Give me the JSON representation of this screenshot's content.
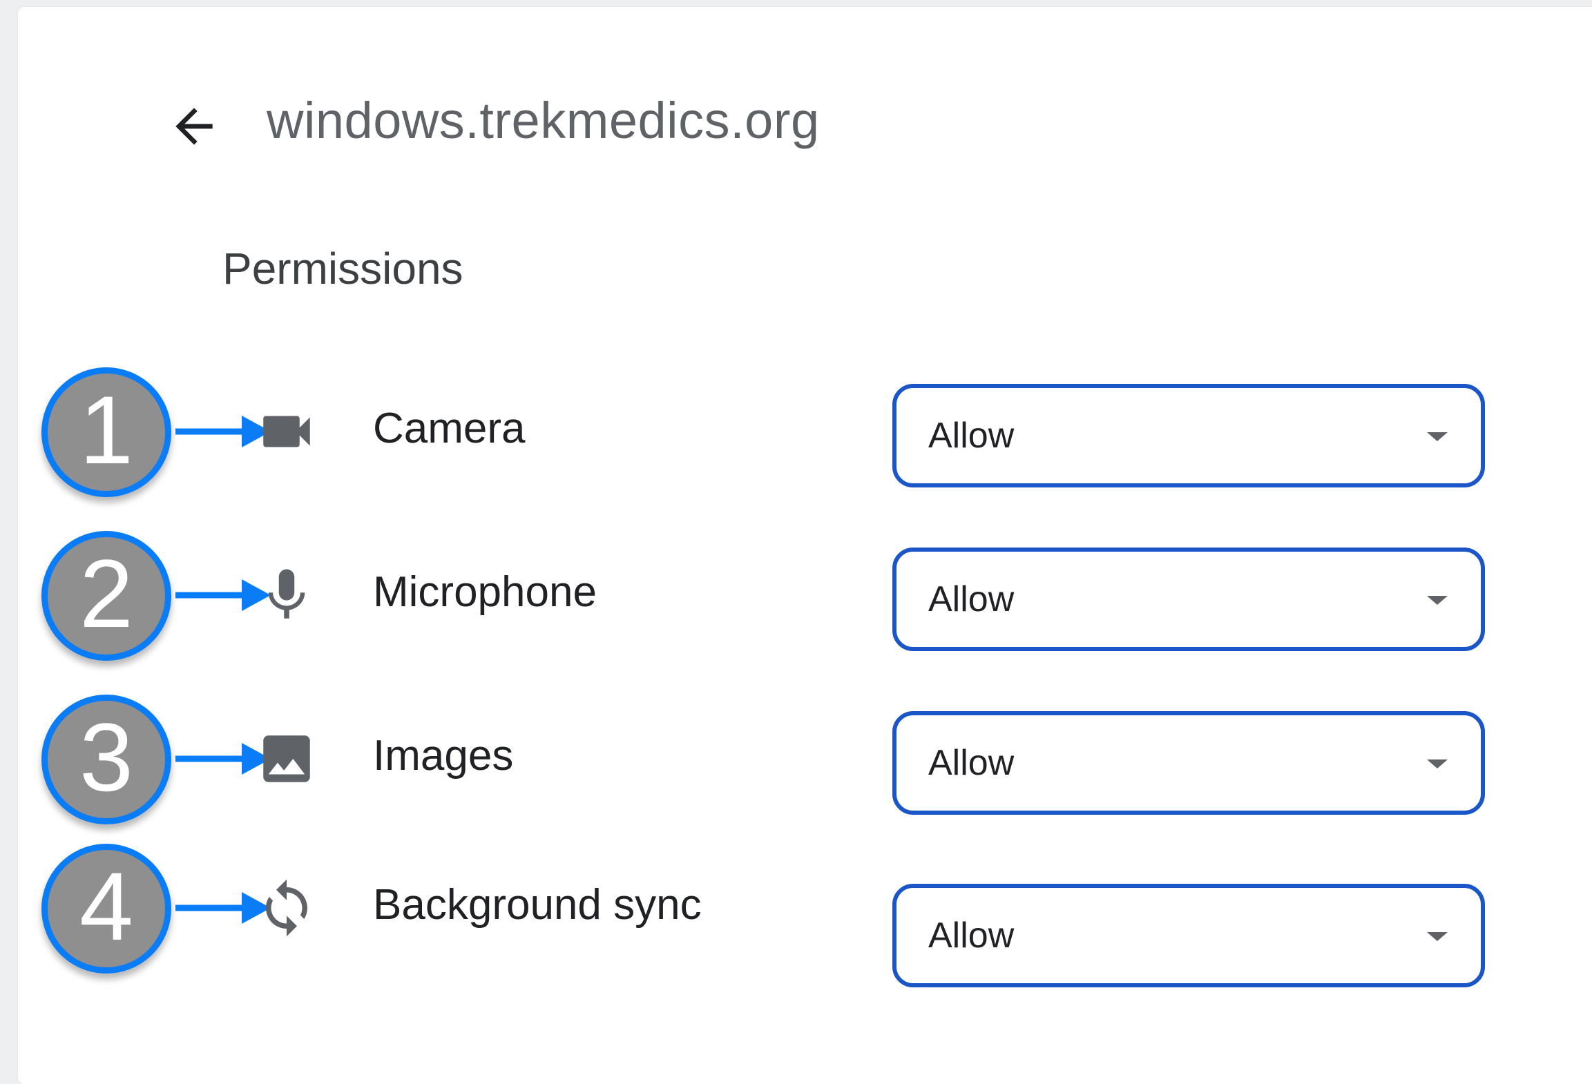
{
  "header": {
    "back_icon": "arrow-back-icon",
    "site": "windows.trekmedics.org"
  },
  "section": {
    "title": "Permissions"
  },
  "colors": {
    "accent_blue": "#0a7cf5",
    "select_border": "#1a56c8",
    "badge_gray": "#8f8f8f",
    "icon_gray": "#5f6368"
  },
  "permissions": [
    {
      "badge": "1",
      "icon": "camera-icon",
      "label": "Camera",
      "value": "Allow"
    },
    {
      "badge": "2",
      "icon": "microphone-icon",
      "label": "Microphone",
      "value": "Allow"
    },
    {
      "badge": "3",
      "icon": "image-icon",
      "label": "Images",
      "value": "Allow"
    },
    {
      "badge": "4",
      "icon": "sync-icon",
      "label": "Background sync",
      "value": "Allow"
    }
  ]
}
